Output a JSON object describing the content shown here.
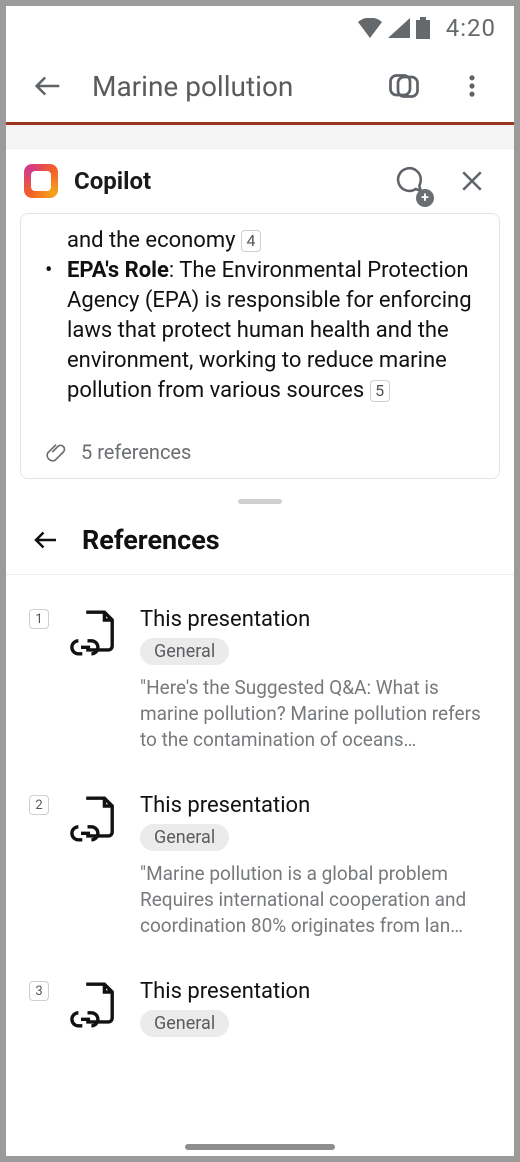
{
  "status": {
    "time": "4:20"
  },
  "header": {
    "title": "Marine pollution"
  },
  "copilot": {
    "title": "Copilot",
    "message": {
      "truncated_prev": "and the economy",
      "truncated_prev_cite": "4",
      "bold": "EPA's Role",
      "body": ": The Environmental Protection Agency (EPA) is responsible for enforcing laws that protect human health and the environment, working to reduce marine pollution from various sources",
      "cite": "5"
    },
    "refs_count": "5 references"
  },
  "refs": {
    "title": "References",
    "items": [
      {
        "num": "1",
        "title": "This presentation",
        "tag": "General",
        "desc": "\"Here's the Suggested Q&A:   What is marine pollution?   Marine pollution refers to the contamination of oceans…"
      },
      {
        "num": "2",
        "title": "This presentation",
        "tag": "General",
        "desc": "\"Marine pollution is a global problem Requires international cooperation and coordination 80% originates from lan…"
      },
      {
        "num": "3",
        "title": "This presentation",
        "tag": "General",
        "desc": ""
      }
    ]
  }
}
